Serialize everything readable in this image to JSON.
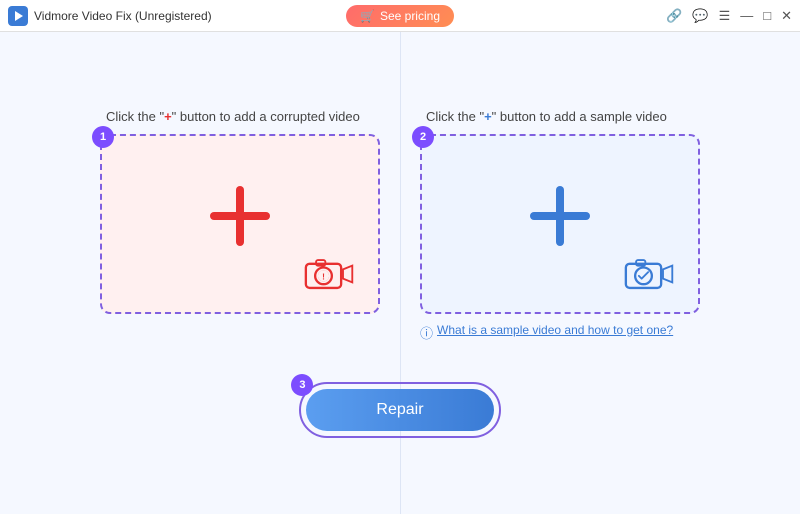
{
  "titlebar": {
    "logo_alt": "Vidmore Video Fix",
    "title": "Vidmore Video Fix (Unregistered)",
    "pricing_btn": "See pricing",
    "window_controls": {
      "minimize": "—",
      "maximize": "□",
      "close": "✕"
    }
  },
  "panels": {
    "left": {
      "label_prefix": "Click the \"",
      "label_plus": "+",
      "label_suffix": "\" button to add a corrupted video",
      "badge": "1",
      "plus_color": "red"
    },
    "right": {
      "label_prefix": "Click the \"",
      "label_plus": "+",
      "label_suffix": "\" button to add a sample video",
      "badge": "2",
      "plus_color": "blue",
      "sample_link": "What is a sample video and how to get one?"
    }
  },
  "repair": {
    "badge": "3",
    "button_label": "Repair"
  },
  "icons": {
    "link": "🔗",
    "message": "💬",
    "menu": "☰",
    "cart": "🛒",
    "question": "?"
  }
}
